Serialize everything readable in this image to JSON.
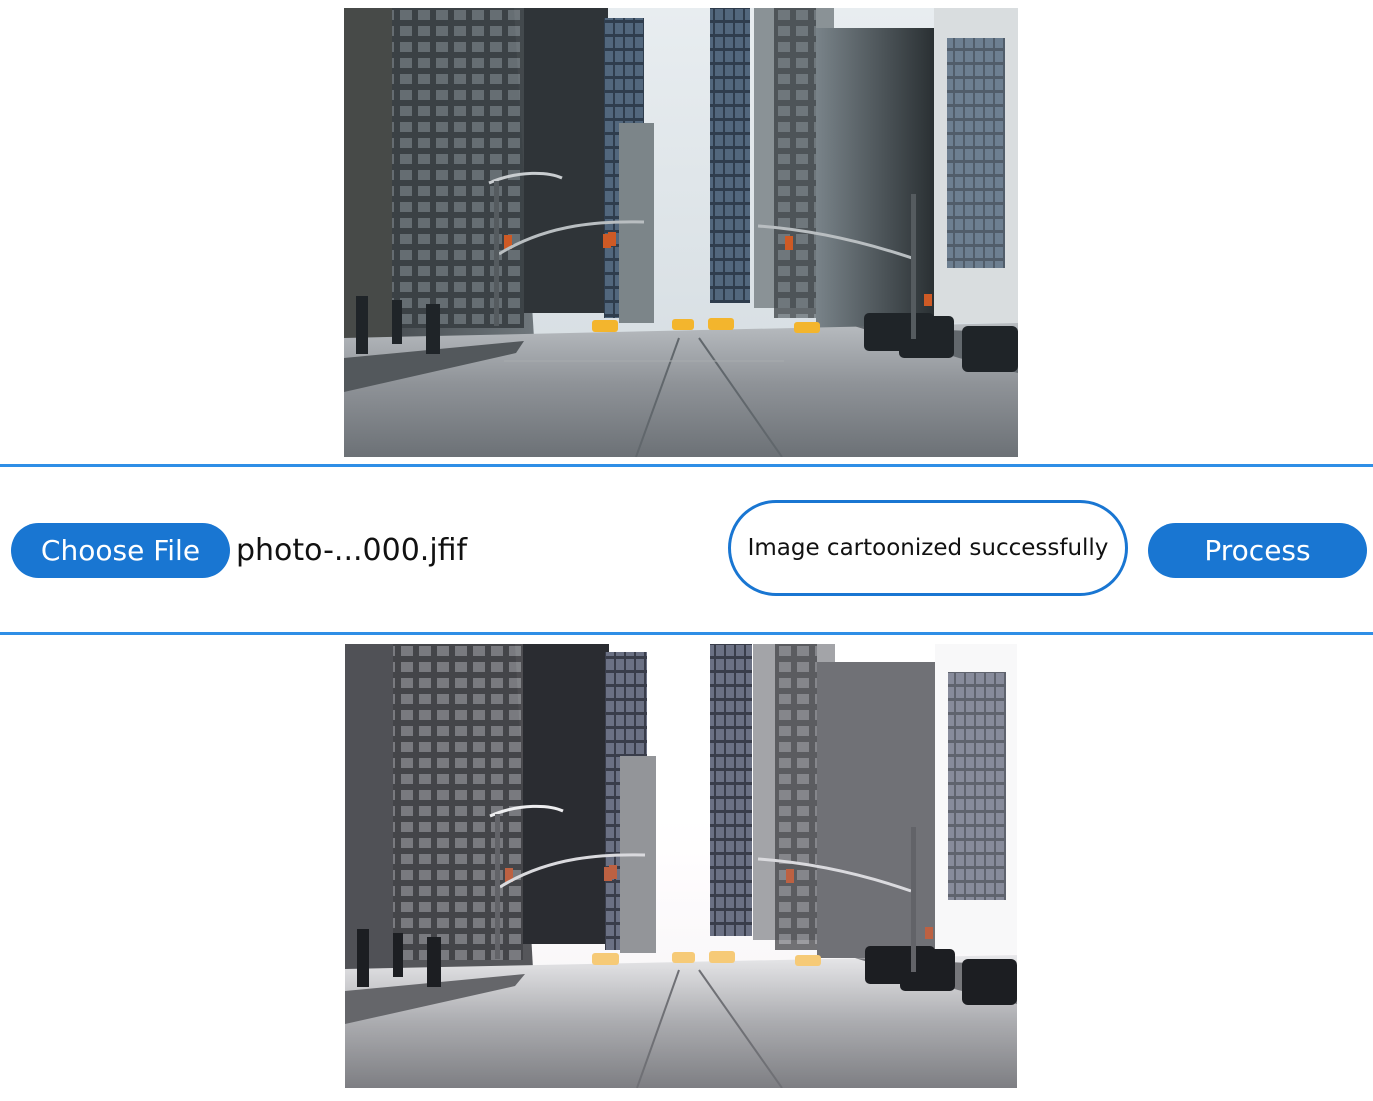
{
  "images": {
    "original": {
      "kind": "city street photograph",
      "alt": "Original city street photo"
    },
    "processed": {
      "kind": "cartoonized city street image",
      "alt": "Cartoonized city street image"
    }
  },
  "controls": {
    "choose_file_label": "Choose File",
    "file_name": "photo-...000.jfif",
    "status_message": "Image cartoonized successfully",
    "process_label": "Process"
  },
  "colors": {
    "accent": "#1976d2",
    "divider": "#2e8ee6",
    "text": "#111111",
    "background": "#ffffff"
  }
}
